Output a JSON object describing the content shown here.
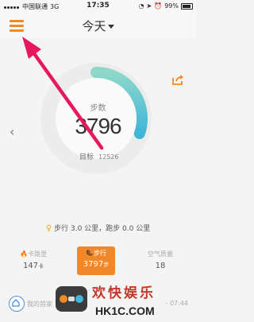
{
  "status": {
    "carrier": "中国联通",
    "network": "3G",
    "time": "17:35",
    "battery": "99%"
  },
  "header": {
    "title": "今天"
  },
  "ring": {
    "label": "步数",
    "steps": "3796",
    "goal_label": "目标",
    "goal": "12526",
    "progress_fraction": 0.303
  },
  "summary": "步行 3.0 公里，跑步 0.0 公里",
  "stats": {
    "calories": {
      "label": "卡路里",
      "value": "147",
      "unit": "卡"
    },
    "walk": {
      "label": "步行",
      "value": "3797",
      "unit": "步"
    },
    "air": {
      "label": "空气质量",
      "value": "18"
    }
  },
  "bottom": {
    "caption": "我的首家",
    "time": "- 07:44"
  },
  "watermark": {
    "line1": "欢快娱乐",
    "line2": "HK1C.COM"
  },
  "colors": {
    "accent": "#f08a22",
    "ring_start": "#8fd8c8",
    "ring_end": "#3fb6d8",
    "annotation": "#e8185f"
  }
}
